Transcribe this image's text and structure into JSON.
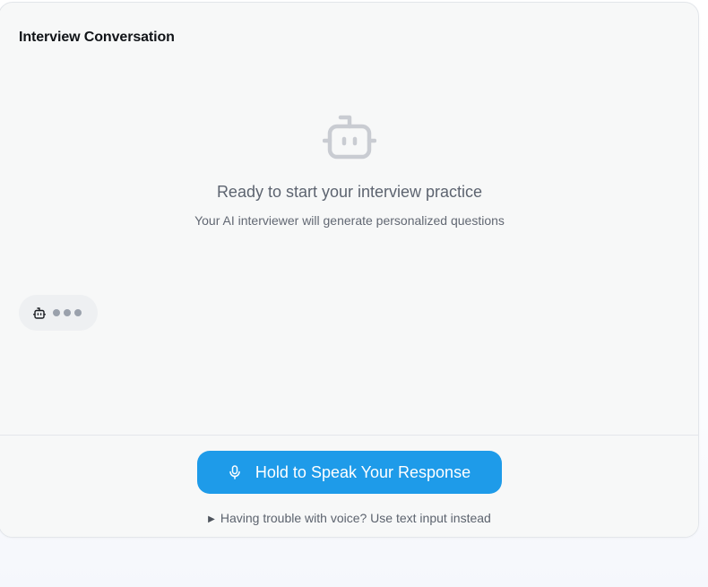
{
  "conversation": {
    "title": "Interview Conversation",
    "empty_state": {
      "icon": "robot-icon",
      "heading": "Ready to start your interview practice",
      "subtext": "Your AI interviewer will generate personalized questions"
    },
    "typing_indicator": {
      "icon": "robot-icon",
      "dots": 3
    }
  },
  "footer": {
    "speak_button": {
      "icon": "microphone-icon",
      "label": "Hold to Speak Your Response"
    },
    "fallback": {
      "icon": "triangle-right-icon",
      "label": "Having trouble with voice? Use text input instead"
    }
  },
  "colors": {
    "accent": "#1e9be9",
    "card_background": "#f7f8f8",
    "muted_icon": "#c9ccd2",
    "text_muted": "#5d6470"
  }
}
